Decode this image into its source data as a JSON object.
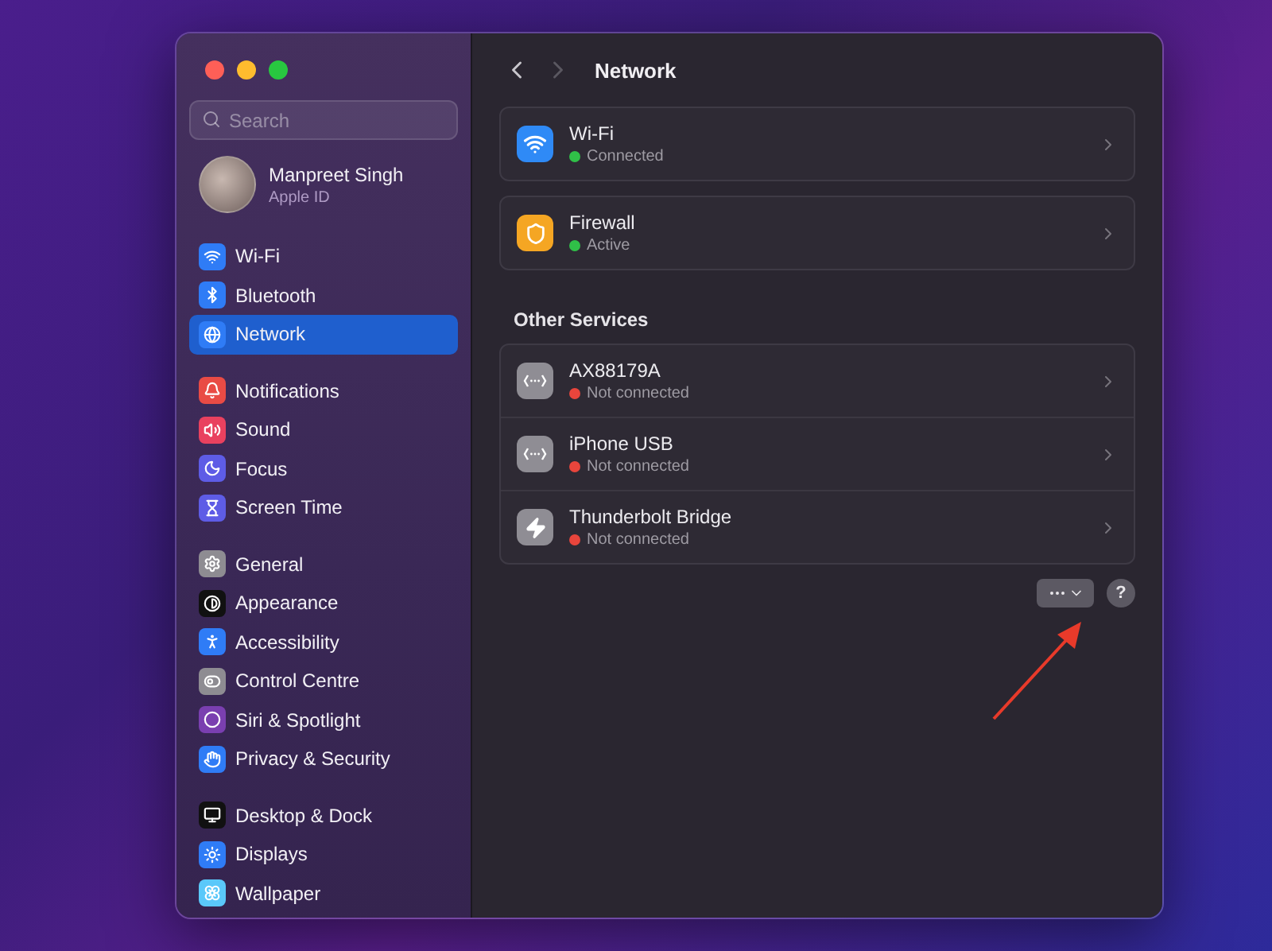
{
  "sidebar": {
    "search": {
      "placeholder": "Search"
    },
    "account": {
      "name": "Manpreet Singh",
      "subtitle": "Apple ID"
    },
    "groups": [
      [
        {
          "label": "Wi-Fi",
          "kind": "wifi",
          "selected": false
        },
        {
          "label": "Bluetooth",
          "kind": "bluetooth",
          "selected": false
        },
        {
          "label": "Network",
          "kind": "network",
          "selected": true
        }
      ],
      [
        {
          "label": "Notifications",
          "kind": "notifications",
          "selected": false
        },
        {
          "label": "Sound",
          "kind": "sound",
          "selected": false
        },
        {
          "label": "Focus",
          "kind": "focus",
          "selected": false
        },
        {
          "label": "Screen Time",
          "kind": "screentime",
          "selected": false
        }
      ],
      [
        {
          "label": "General",
          "kind": "general",
          "selected": false
        },
        {
          "label": "Appearance",
          "kind": "appearance",
          "selected": false
        },
        {
          "label": "Accessibility",
          "kind": "accessibility",
          "selected": false
        },
        {
          "label": "Control Centre",
          "kind": "controlcentre",
          "selected": false
        },
        {
          "label": "Siri & Spotlight",
          "kind": "siri",
          "selected": false
        },
        {
          "label": "Privacy & Security",
          "kind": "privacy",
          "selected": false
        }
      ],
      [
        {
          "label": "Desktop & Dock",
          "kind": "desktop",
          "selected": false
        },
        {
          "label": "Displays",
          "kind": "displays",
          "selected": false
        },
        {
          "label": "Wallpaper",
          "kind": "wallpaper",
          "selected": false
        }
      ]
    ]
  },
  "header": {
    "title": "Network",
    "back_disabled": false,
    "forward_disabled": true
  },
  "services": [
    {
      "name": "Wi-Fi",
      "kind": "wifi",
      "status": "Connected",
      "color": "#30c048"
    },
    {
      "name": "Firewall",
      "kind": "firewall",
      "status": "Active",
      "color": "#30c048"
    }
  ],
  "other_services": {
    "heading": "Other Services",
    "items": [
      {
        "name": "AX88179A",
        "kind": "ethernet",
        "status": "Not connected",
        "color": "#e8453c"
      },
      {
        "name": "iPhone USB",
        "kind": "ethernet",
        "status": "Not connected",
        "color": "#e8453c"
      },
      {
        "name": "Thunderbolt Bridge",
        "kind": "thunderbolt",
        "status": "Not connected",
        "color": "#e8453c"
      }
    ]
  },
  "help_button": {
    "label": "?"
  }
}
